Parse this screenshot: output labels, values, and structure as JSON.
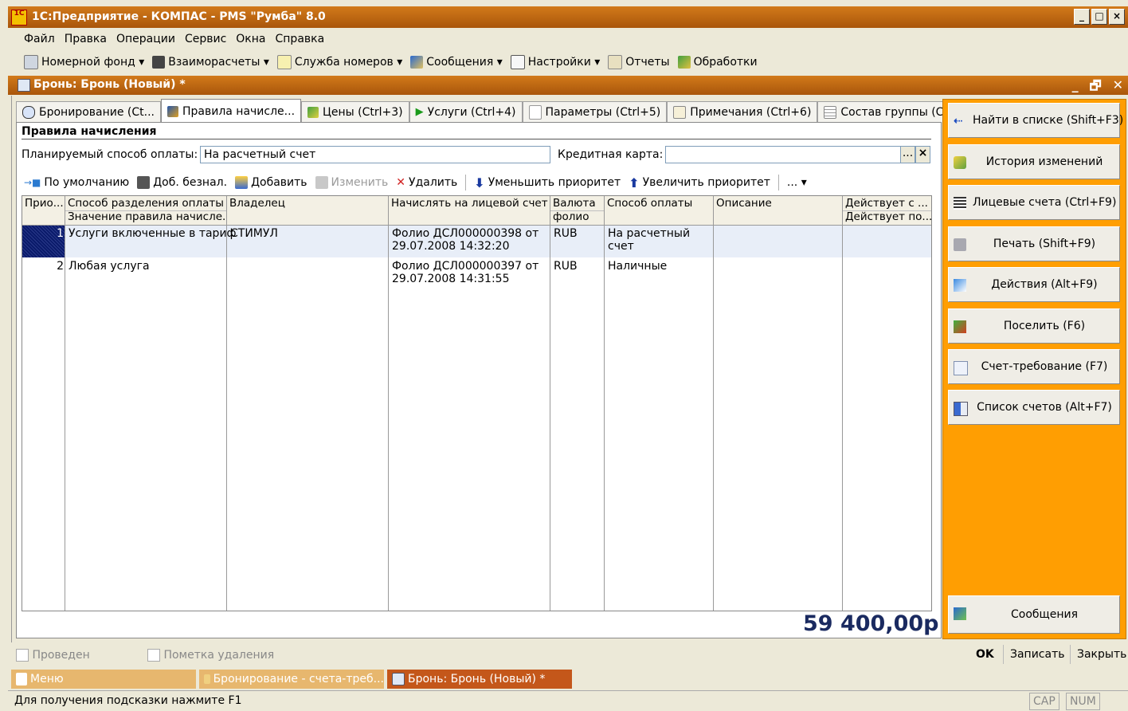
{
  "app_title": "1С:Предприятие - КОМПАС - PMS \"Румба\" 8.0",
  "app_logo": "1С",
  "window_buttons": [
    "_",
    "□",
    "×"
  ],
  "menu": [
    "Файл",
    "Правка",
    "Операции",
    "Сервис",
    "Окна",
    "Справка"
  ],
  "toolbar": [
    {
      "label": "Номерной фонд ▾",
      "icon": "building-icon"
    },
    {
      "label": "Взаиморасчеты ▾",
      "icon": "calculator-icon"
    },
    {
      "label": "Служба номеров ▾",
      "icon": "checklist-icon"
    },
    {
      "label": "Сообщения ▾",
      "icon": "messages-icon"
    },
    {
      "label": "Настройки ▾",
      "icon": "settings-icon"
    },
    {
      "label": "Отчеты",
      "icon": "report-icon"
    },
    {
      "label": "Обработки",
      "icon": "processing-icon"
    }
  ],
  "doc_title": "Бронь: Бронь (Новый) *",
  "doc_controls": [
    "_",
    "🗗",
    "✕"
  ],
  "tabs": [
    {
      "label": "Бронирование (Ct...",
      "active": false
    },
    {
      "label": "Правила начисле...",
      "active": true
    },
    {
      "label": "Цены (Ctrl+3)",
      "active": false
    },
    {
      "label": "Услуги (Ctrl+4)",
      "active": false
    },
    {
      "label": "Параметры (Ctrl+5)",
      "active": false
    },
    {
      "label": "Примечания (Ctrl+6)",
      "active": false
    },
    {
      "label": "Состав группы (C...",
      "active": false
    }
  ],
  "section_title": "Правила начисления",
  "form": {
    "payment_label": "Планируемый способ оплаты:",
    "payment_value": "На расчетный счет",
    "card_label": "Кредитная карта:",
    "card_value": "",
    "ellipsis": "...",
    "clear": "×"
  },
  "grid_toolbar": {
    "default": "По умолчанию",
    "add_noncash": "Доб. безнал.",
    "add": "Добавить",
    "edit": "Изменить",
    "delete": "Удалить",
    "decrease": "Уменьшить приоритет",
    "increase": "Увеличить приоритет",
    "more": "... ▾"
  },
  "grid": {
    "headers": {
      "prio": "Прио...",
      "split_top": "Способ разделения оплаты",
      "split_bottom": "Значение правила начисле...",
      "owner": "Владелец",
      "folio": "Начислять на лицевой счет",
      "currency_top": "Валюта",
      "currency_bottom": "фолио",
      "paymethod": "Способ оплаты",
      "desc": "Описание",
      "valid_top": "Действует с ...",
      "valid_bottom": "Действует по..."
    },
    "rows": [
      {
        "prio": "1",
        "split": "Услуги включенные в тариф",
        "owner": "СТИМУЛ",
        "folio1": "Фолио ДСЛ000000398 от",
        "folio2": "29.07.2008 14:32:20",
        "currency": "RUB",
        "pay1": "На расчетный",
        "pay2": "счет",
        "desc": "",
        "valid": ""
      },
      {
        "prio": "2",
        "split": "Любая услуга",
        "owner": "",
        "folio1": "Фолио ДСЛ000000397 от",
        "folio2": "29.07.2008 14:31:55",
        "currency": "RUB",
        "pay1": "Наличные",
        "pay2": "",
        "desc": "",
        "valid": ""
      }
    ]
  },
  "total": "59 400,00р",
  "side_buttons": [
    {
      "label": "Найти в списке (Shift+F3)",
      "icon": "find-in-list-icon"
    },
    {
      "label": "История изменений",
      "icon": "history-icon"
    },
    {
      "label": "Лицевые счета (Ctrl+F9)",
      "icon": "accounts-icon"
    },
    {
      "label": "Печать (Shift+F9)",
      "icon": "printer-icon"
    },
    {
      "label": "Действия (Alt+F9)",
      "icon": "actions-icon"
    },
    {
      "label": "Поселить (F6)",
      "icon": "checkin-icon"
    },
    {
      "label": "Счет-требование (F7)",
      "icon": "invoice-icon"
    },
    {
      "label": "Список счетов (Alt+F7)",
      "icon": "invoice-list-icon"
    }
  ],
  "messages_button": "Сообщения",
  "footer": {
    "posted": "Проведен",
    "deletion_mark": "Пометка удаления",
    "ok": "OK",
    "save": "Записать",
    "close": "Закрыть"
  },
  "taskbar": [
    "Меню",
    "Бронирование - счета-треб...",
    "Бронь: Бронь (Новый) *"
  ],
  "status": {
    "hint": "Для получения подсказки нажмите F1",
    "cap": "CAP",
    "num": "NUM"
  },
  "colors": {
    "title_bar": "#c06812",
    "side_panel": "#ff9e02",
    "total": "#1a2a60",
    "selection": "#0a1a6a"
  }
}
